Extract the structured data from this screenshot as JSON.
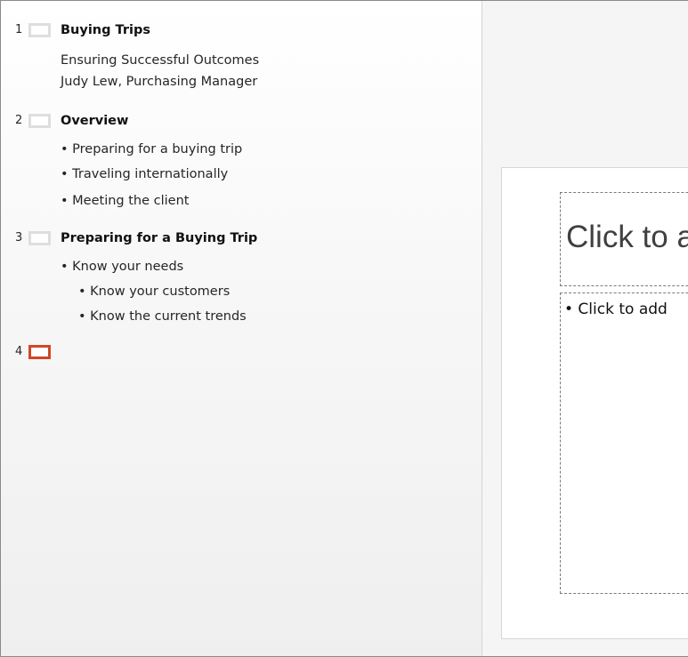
{
  "outline": {
    "slides": [
      {
        "number": "1",
        "title": "Buying Trips",
        "lines": [
          "Ensuring Successful Outcomes",
          "Judy Lew, Purchasing Manager"
        ]
      },
      {
        "number": "2",
        "title": "Overview",
        "lines": [
          "• Preparing for a buying trip",
          "• Traveling internationally",
          "• Meeting the client"
        ]
      },
      {
        "number": "3",
        "title": "Preparing for a Buying Trip",
        "lines": [
          "• Know your needs",
          "• Know your customers",
          "• Know the current trends"
        ]
      },
      {
        "number": "4",
        "title": "",
        "lines": []
      }
    ]
  },
  "editor": {
    "title_placeholder": "Click to a",
    "content_placeholder": "• Click to add"
  },
  "colors": {
    "active_slide_accent": "#d24726",
    "inactive_thumb": "#dedede"
  }
}
